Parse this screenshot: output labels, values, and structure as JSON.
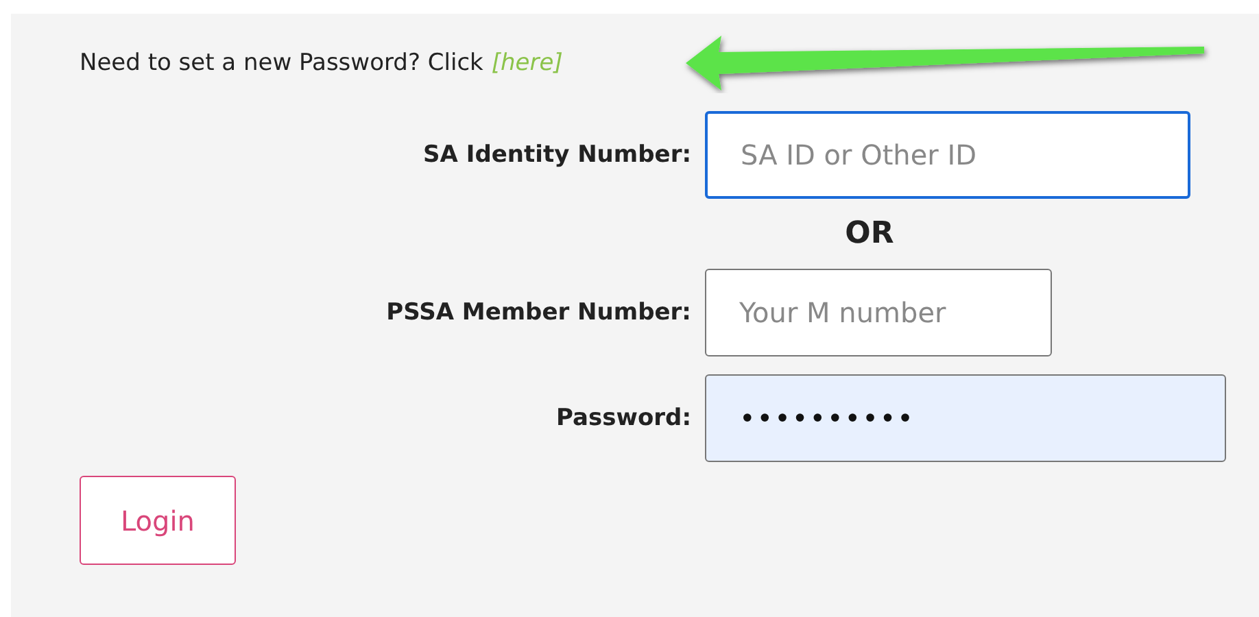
{
  "notice": {
    "text": "Need to set a new Password? Click",
    "link": "[here]"
  },
  "fields": [
    {
      "label": "SA Identity Number:",
      "placeholder": "SA ID or Other ID",
      "focused": true,
      "autofilled": false
    },
    {
      "label": "PSSA Member Number:",
      "placeholder": "Your M number",
      "focused": false,
      "autofilled": false
    },
    {
      "label": "Password:",
      "value": "••••••••••",
      "focused": false,
      "autofilled": true
    }
  ],
  "separator": "OR",
  "login_button": "Login"
}
